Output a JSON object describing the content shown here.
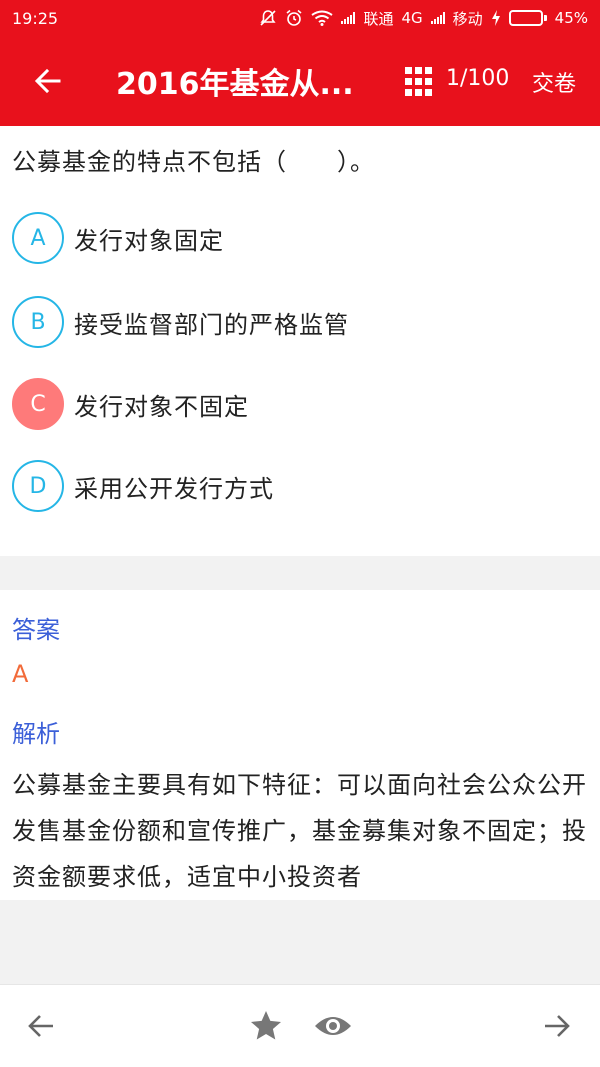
{
  "status": {
    "time": "19:25",
    "carrier1": "联通",
    "network": "4G",
    "carrier2": "移动",
    "battery_percent": "45%",
    "battery_level": 0.45
  },
  "appbar": {
    "title": "2016年基金从...",
    "progress": "1/100",
    "submit_label": "交卷",
    "icons": [
      "back-arrow-icon",
      "grid-icon"
    ]
  },
  "question": {
    "text": "公募基金的特点不包括（　　）。",
    "options": [
      {
        "letter": "A",
        "text": "发行对象固定"
      },
      {
        "letter": "B",
        "text": "接受监督部门的严格监管"
      },
      {
        "letter": "C",
        "text": "发行对象不固定"
      },
      {
        "letter": "D",
        "text": "采用公开发行方式"
      }
    ],
    "selected": "C"
  },
  "answer": {
    "label": "答案",
    "value": "A",
    "analysis_label": "解析",
    "analysis_text": "公募基金主要具有如下特征：可以面向社会公众公开发售基金份额和宣传推广，基金募集对象不固定；投资金额要求低，适宜中小投资者"
  },
  "bottom_bar": {
    "icons": [
      "arrow-left-icon",
      "star-icon",
      "eye-icon",
      "arrow-right-icon"
    ]
  },
  "colors": {
    "brand_red": "#e8111c",
    "option_blue": "#25b6e6",
    "selected_red": "#fe7a7a",
    "label_blue": "#3b5fd8",
    "answer_orange": "#f26b3a"
  }
}
